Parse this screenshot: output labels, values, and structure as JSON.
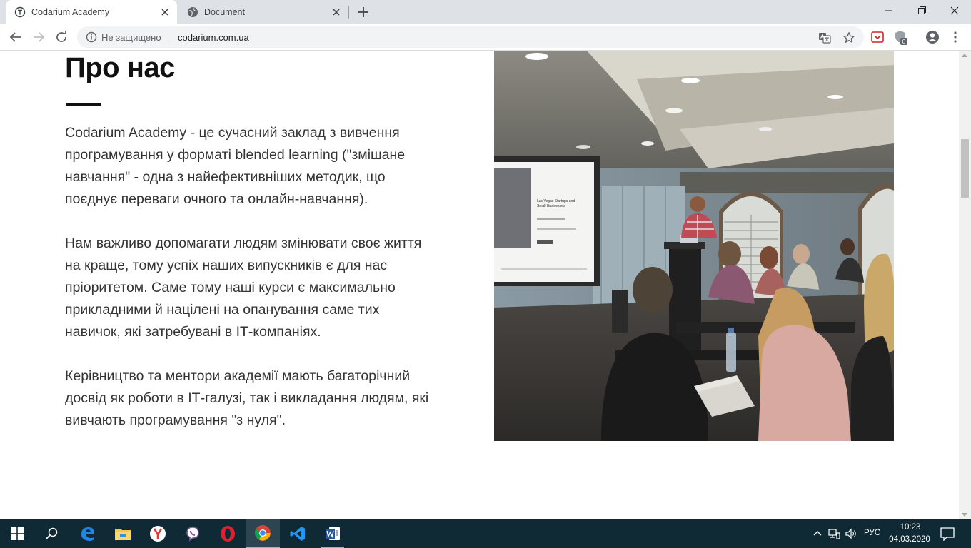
{
  "browser": {
    "tabs": [
      {
        "title": "Codarium Academy",
        "active": true,
        "icon": "codarium-favicon"
      },
      {
        "title": "Document",
        "active": false,
        "icon": "globe-icon"
      }
    ],
    "address": {
      "security_label": "Не защищено",
      "url": "codarium.com.ua"
    },
    "extension_badge": "0"
  },
  "page": {
    "heading": "Про нас",
    "paragraphs": [
      "Codarium Academy - це сучасний заклад з вивчення програмування у форматі blended learning (\"змішане навчання\" - одна з найефективніших методик, що поєднує переваги очного та онлайн-навчання).",
      "Нам важливо допомагати людям змінювати своє життя на краще, тому успіх наших випускників є для нас пріоритетом. Саме тому наші курси є максимально прикладними й націлені на опанування саме тих навичок, які затребувані в ІТ-компаніях.",
      "Керівництво та ментори академії мають багаторічний досвід як роботи в ІТ-галузі, так і викладання людям, які вивчають програмування \"з нуля\"."
    ],
    "photo_screen_text": [
      "Las Vegas Startups and",
      "Small Businesses"
    ]
  },
  "taskbar": {
    "apps": [
      "start",
      "search",
      "edge",
      "file-explorer",
      "yandex-browser",
      "viber",
      "opera",
      "chrome",
      "vscode",
      "word"
    ],
    "language": "РУС",
    "time": "10:23",
    "date": "04.03.2020"
  },
  "colors": {
    "tabstrip": "#dee1e6",
    "taskbar": "#0f2a35",
    "heading": "#111111",
    "body_text": "#333333"
  }
}
